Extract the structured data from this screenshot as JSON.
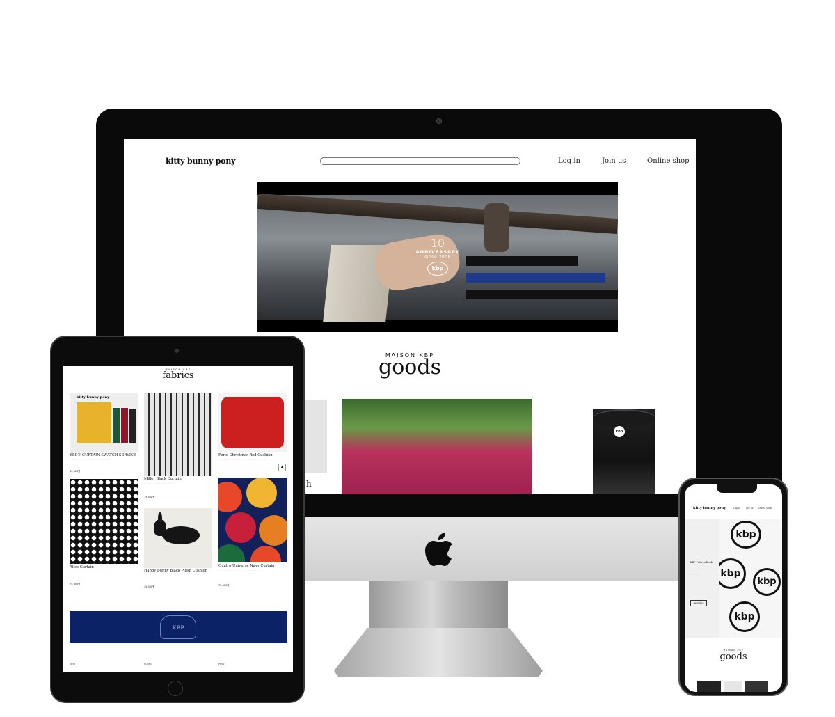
{
  "desktop": {
    "logo": "kitty bunny pony",
    "nav": [
      "Log in",
      "Join us",
      "Online shop"
    ],
    "hero": {
      "number": "10",
      "label": "ANNIVERSARY",
      "since": "since 2008",
      "badge": "kbp"
    },
    "section": {
      "subtitle": "MAISON KBP",
      "title": "goods"
    },
    "card_badge": "kbp",
    "card1_text": "h"
  },
  "tablet": {
    "section": {
      "subtitle": "MAISON KBP",
      "title": "fabrics"
    },
    "swatch_label": "kitty bunny pony",
    "products": [
      {
        "name": "KBP® CURTAIN SWATCH SERVICE",
        "price": "15,000원"
      },
      {
        "name": "Miller Black Curtain",
        "price": "75,000원"
      },
      {
        "name": "Porto Christmas Red Cushion",
        "price": ""
      },
      {
        "name": "Alice Curtain",
        "price": "75,000원"
      },
      {
        "name": "Happy Bunny Black Plush Cushion",
        "price": "45,000원"
      },
      {
        "name": "Quatro Universe Navy Curtain",
        "price": "75,000원"
      }
    ],
    "banner_logo": "KBP",
    "footer": [
      "Kitty",
      "Bunny",
      "Pony"
    ]
  },
  "phone": {
    "logo": "kitty bunny pony",
    "nav": [
      "Log in",
      "Join us",
      "Online shop"
    ],
    "promo": {
      "title": "KBP Pattern Book",
      "button": "Read More"
    },
    "pattern_text": "kbp",
    "section": {
      "subtitle": "MAISON KBP",
      "title": "goods"
    }
  },
  "colors": {
    "navy": "#0b2366",
    "red": "#cc1f1f",
    "mustard": "#e8b32a"
  }
}
